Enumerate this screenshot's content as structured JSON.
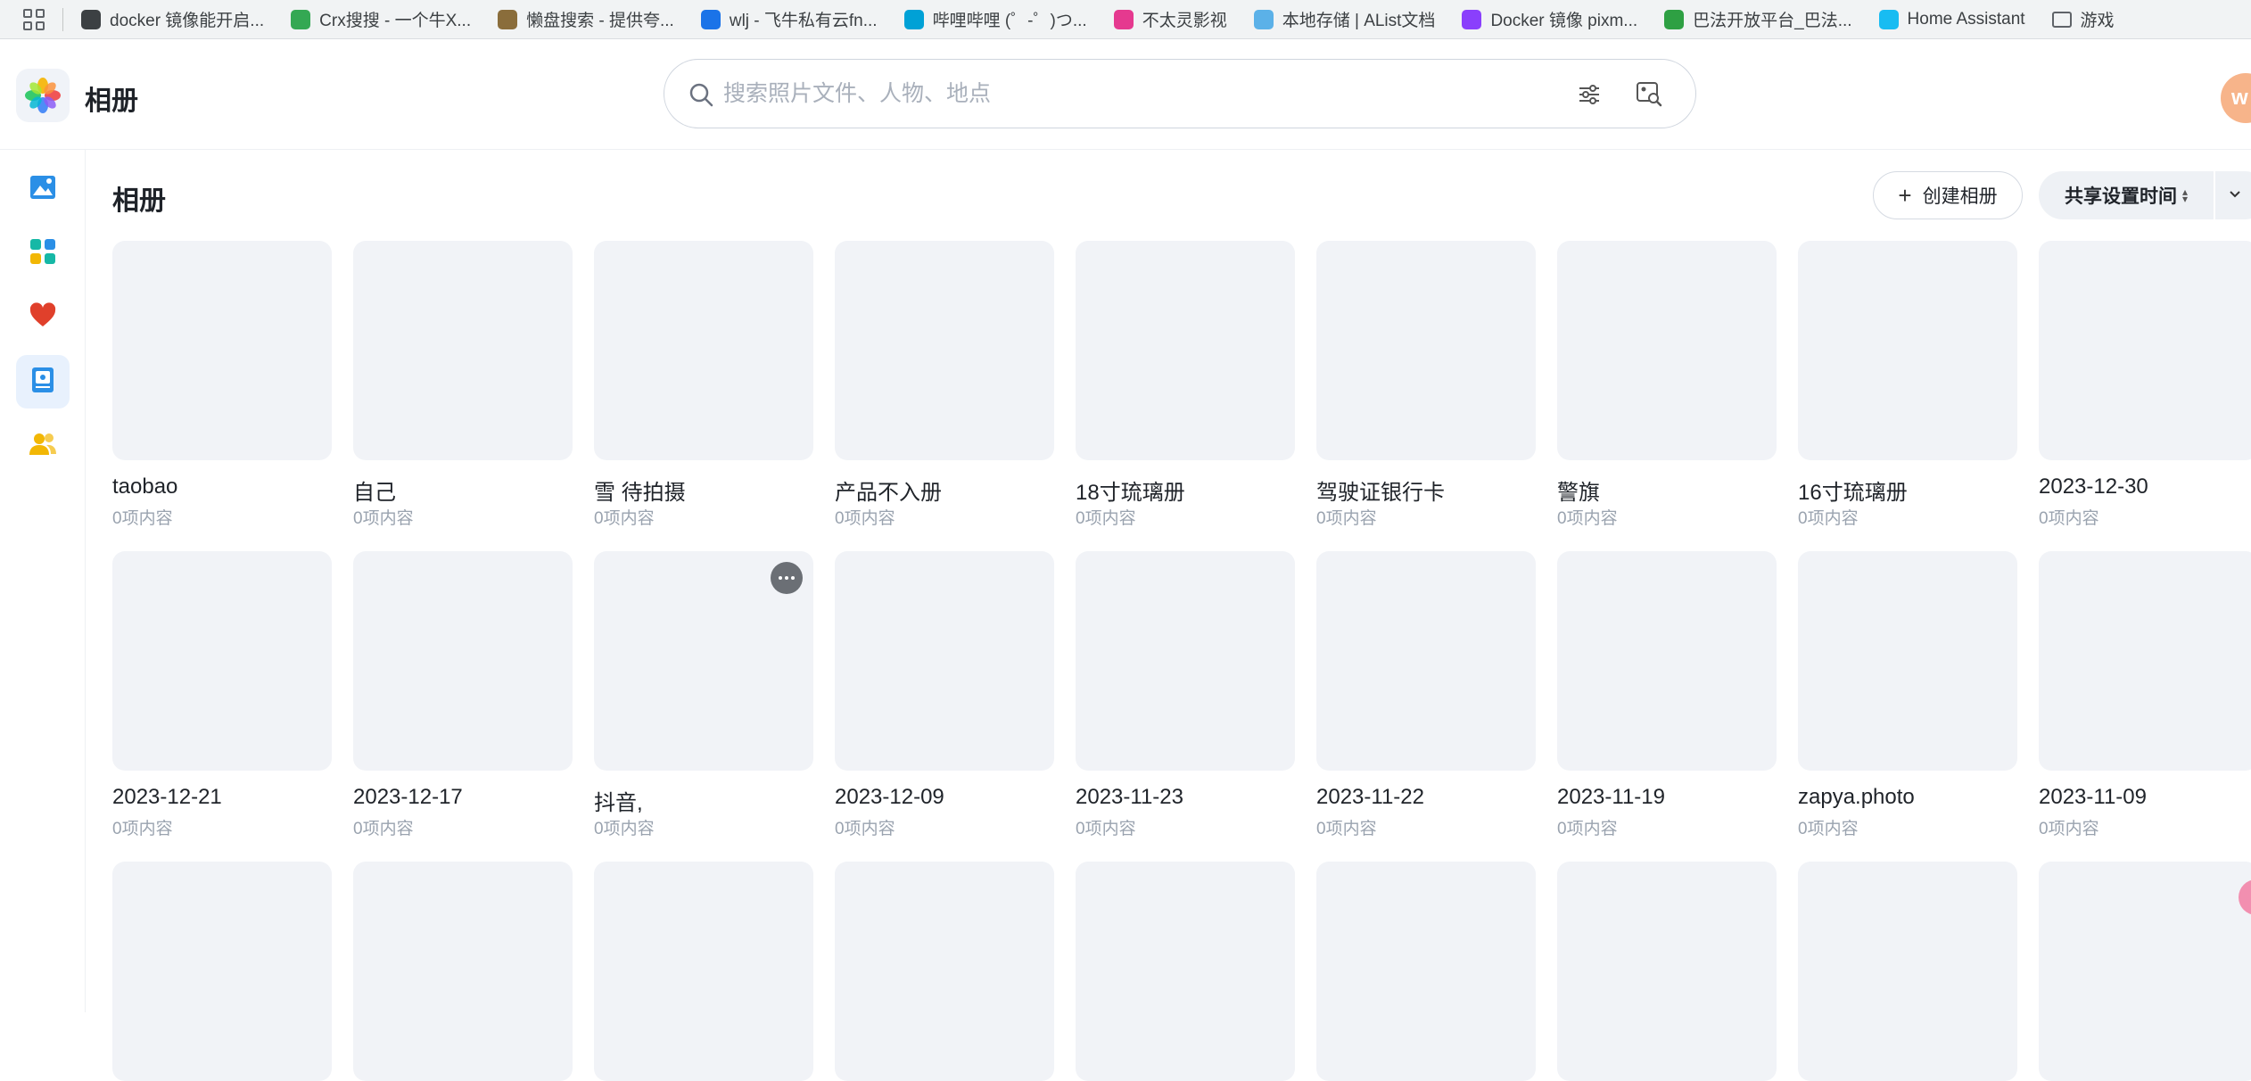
{
  "bookmarks": [
    {
      "label": "docker 镜像能开启...",
      "icon": "globe-icon",
      "color": "#3c4043"
    },
    {
      "label": "Crx搜搜 - 一个牛X...",
      "icon": "chrome-icon",
      "color": "#34a853"
    },
    {
      "label": "懒盘搜索 - 提供夸...",
      "icon": "cloud-icon",
      "color": "#8a6d3b"
    },
    {
      "label": "wlj - 飞牛私有云fn...",
      "icon": "fn-icon",
      "color": "#1a73e8"
    },
    {
      "label": "哔哩哔哩 (゜-゜)つ...",
      "icon": "bilibili-icon",
      "color": "#00a1d6"
    },
    {
      "label": "不太灵影视",
      "icon": "petal-icon",
      "color": "#e5398f"
    },
    {
      "label": "本地存储 | AList文档",
      "icon": "alist-icon",
      "color": "#5bb1e8"
    },
    {
      "label": "Docker 镜像 pixm...",
      "icon": "pixman-icon",
      "color": "#8a3ffc"
    },
    {
      "label": "巴法开放平台_巴法...",
      "icon": "bafa-icon",
      "color": "#2ea043"
    },
    {
      "label": "Home Assistant",
      "icon": "home-assistant-icon",
      "color": "#18bcf2"
    },
    {
      "label": "游戏",
      "icon": "folder-icon",
      "color": "#5f6368"
    }
  ],
  "header": {
    "app_title": "相册",
    "search_placeholder": "搜索照片文件、人物、地点",
    "avatar_letter": "w"
  },
  "sidebar": {
    "items": [
      {
        "name": "photos",
        "icon": "photo-icon",
        "color": "#2b8fe6"
      },
      {
        "name": "categories",
        "icon": "category-icon",
        "color": "#16b8a6"
      },
      {
        "name": "favorites",
        "icon": "heart-icon",
        "color": "#e0402b"
      },
      {
        "name": "albums",
        "icon": "album-icon",
        "color": "#2b8fe6",
        "active": true
      },
      {
        "name": "people",
        "icon": "people-icon",
        "color": "#f2b705"
      }
    ]
  },
  "main": {
    "title": "相册",
    "create_label": "创建相册",
    "sort_label": "共享设置时间",
    "albums": [
      {
        "name": "taobao",
        "count": "0项内容"
      },
      {
        "name": "自己",
        "count": "0项内容"
      },
      {
        "name": "雪 待拍摄",
        "count": "0项内容"
      },
      {
        "name": "产品不入册",
        "count": "0项内容"
      },
      {
        "name": "18寸琉璃册",
        "count": "0项内容"
      },
      {
        "name": "驾驶证银行卡",
        "count": "0项内容"
      },
      {
        "name": "警旗",
        "count": "0项内容"
      },
      {
        "name": "16寸琉璃册",
        "count": "0项内容"
      },
      {
        "name": "2023-12-30",
        "count": "0项内容"
      },
      {
        "name": "2023-12-21",
        "count": "0项内容"
      },
      {
        "name": "2023-12-17",
        "count": "0项内容"
      },
      {
        "name": "抖音,",
        "count": "0项内容",
        "hover": true
      },
      {
        "name": "2023-12-09",
        "count": "0项内容"
      },
      {
        "name": "2023-11-23",
        "count": "0项内容"
      },
      {
        "name": "2023-11-22",
        "count": "0项内容"
      },
      {
        "name": "2023-11-19",
        "count": "0项内容"
      },
      {
        "name": "zapya.photo",
        "count": "0项内容"
      },
      {
        "name": "2023-11-09",
        "count": "0项内容"
      },
      {
        "name": "",
        "count": ""
      },
      {
        "name": "",
        "count": ""
      },
      {
        "name": "",
        "count": ""
      },
      {
        "name": "",
        "count": ""
      },
      {
        "name": "",
        "count": ""
      },
      {
        "name": "",
        "count": ""
      },
      {
        "name": "",
        "count": ""
      },
      {
        "name": "",
        "count": ""
      },
      {
        "name": "",
        "count": ""
      }
    ]
  }
}
